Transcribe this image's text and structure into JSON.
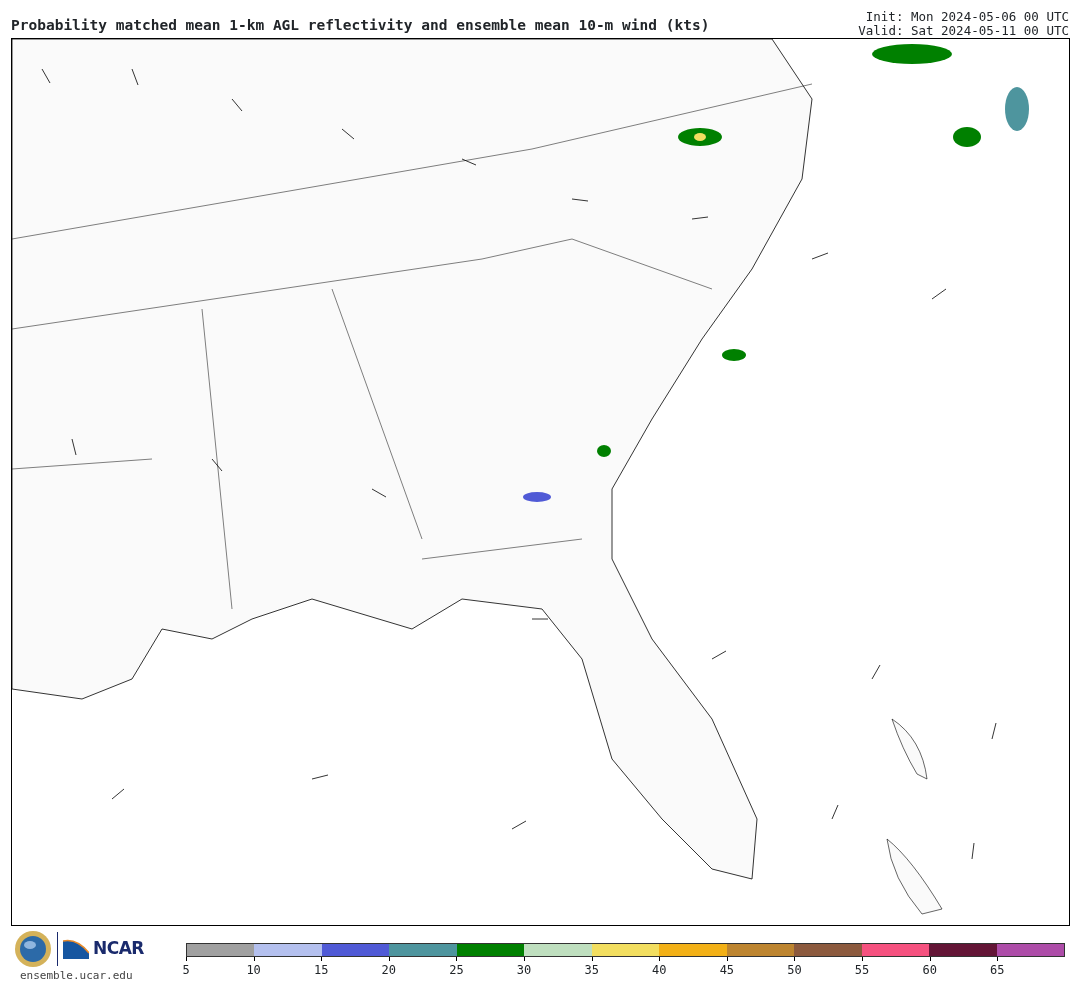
{
  "header": {
    "title": "Probability matched mean 1-km AGL reflectivity and ensemble mean 10-m wind (kts)",
    "init": "Init: Mon 2024-05-06 00 UTC",
    "valid": "Valid: Sat 2024-05-11 00 UTC"
  },
  "footer": {
    "logo_text": "NCAR",
    "site": "ensemble.ucar.edu"
  },
  "colorbar": [
    {
      "label": "5",
      "color": "#a0a0a0"
    },
    {
      "label": "10",
      "color": "#b4c0ee"
    },
    {
      "label": "15",
      "color": "#505ad6"
    },
    {
      "label": "20",
      "color": "#4e959e"
    },
    {
      "label": "25",
      "color": "#008000"
    },
    {
      "label": "30",
      "color": "#bfdfbf"
    },
    {
      "label": "35",
      "color": "#f2de60"
    },
    {
      "label": "40",
      "color": "#f2b016"
    },
    {
      "label": "45",
      "color": "#bd8530"
    },
    {
      "label": "50",
      "color": "#8c5a3e"
    },
    {
      "label": "55",
      "color": "#f5517f"
    },
    {
      "label": "60",
      "color": "#631536"
    },
    {
      "label": "65",
      "color": "#ad4ca8"
    }
  ]
}
